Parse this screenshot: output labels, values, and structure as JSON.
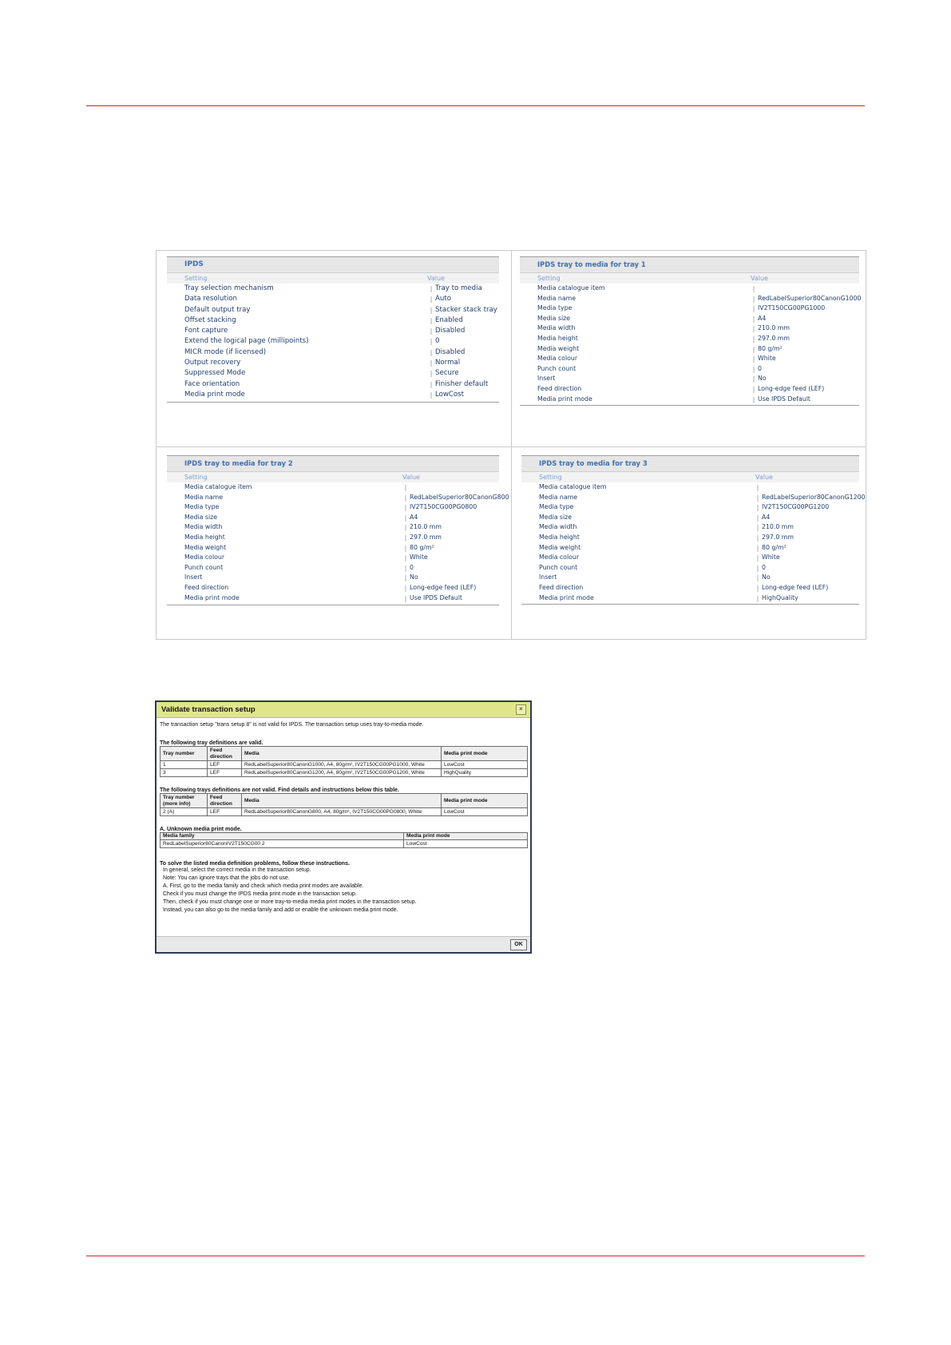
{
  "panels": {
    "ipds": {
      "title": "IPDS",
      "header_setting": "Setting",
      "header_value": "Value",
      "rows": [
        {
          "setting": "Tray selection mechanism",
          "value": "Tray to media"
        },
        {
          "setting": "Data resolution",
          "value": "Auto"
        },
        {
          "setting": "Default output tray",
          "value": "Stacker stack tray"
        },
        {
          "setting": "Offset stacking",
          "value": "Enabled"
        },
        {
          "setting": "Font capture",
          "value": "Disabled"
        },
        {
          "setting": "Extend the logical page (millipoints)",
          "value": "0"
        },
        {
          "setting": "MICR mode (if licensed)",
          "value": "Disabled"
        },
        {
          "setting": "Output recovery",
          "value": "Normal"
        },
        {
          "setting": "Suppressed Mode",
          "value": "Secure"
        },
        {
          "setting": "Face orientation",
          "value": "Finisher default"
        },
        {
          "setting": "Media print mode",
          "value": "LowCost"
        }
      ]
    },
    "tray1": {
      "title": "IPDS tray to media for tray 1",
      "header_setting": "Setting",
      "header_value": "Value",
      "rows": [
        {
          "setting": "Media catalogue item",
          "value": ""
        },
        {
          "setting": "Media name",
          "value": "RedLabelSuperior80CanonG1000"
        },
        {
          "setting": "Media type",
          "value": "IV2T150CG00PG1000"
        },
        {
          "setting": "Media size",
          "value": "A4"
        },
        {
          "setting": "Media width",
          "value": "210.0 mm"
        },
        {
          "setting": "Media height",
          "value": "297.0 mm"
        },
        {
          "setting": "Media weight",
          "value": "80 g/m²"
        },
        {
          "setting": "Media colour",
          "value": "White"
        },
        {
          "setting": "Punch count",
          "value": "0"
        },
        {
          "setting": "Insert",
          "value": "No"
        },
        {
          "setting": "Feed direction",
          "value": "Long-edge feed (LEF)"
        },
        {
          "setting": "Media print mode",
          "value": "Use IPDS Default"
        }
      ]
    },
    "tray2": {
      "title": "IPDS tray to media for tray 2",
      "header_setting": "Setting",
      "header_value": "Value",
      "rows": [
        {
          "setting": "Media catalogue item",
          "value": ""
        },
        {
          "setting": "Media name",
          "value": "RedLabelSuperior80CanonG800"
        },
        {
          "setting": "Media type",
          "value": "IV2T150CG00PG0800"
        },
        {
          "setting": "Media size",
          "value": "A4"
        },
        {
          "setting": "Media width",
          "value": "210.0 mm"
        },
        {
          "setting": "Media height",
          "value": "297.0 mm"
        },
        {
          "setting": "Media weight",
          "value": "80 g/m²"
        },
        {
          "setting": "Media colour",
          "value": "White"
        },
        {
          "setting": "Punch count",
          "value": "0"
        },
        {
          "setting": "Insert",
          "value": "No"
        },
        {
          "setting": "Feed direction",
          "value": "Long-edge feed (LEF)"
        },
        {
          "setting": "Media print mode",
          "value": "Use IPDS Default"
        }
      ]
    },
    "tray3": {
      "title": "IPDS tray to media for tray 3",
      "header_setting": "Setting",
      "header_value": "Value",
      "rows": [
        {
          "setting": "Media catalogue item",
          "value": ""
        },
        {
          "setting": "Media name",
          "value": "RedLabelSuperior80CanonG1200"
        },
        {
          "setting": "Media type",
          "value": "IV2T150CG00PG1200"
        },
        {
          "setting": "Media size",
          "value": "A4"
        },
        {
          "setting": "Media width",
          "value": "210.0 mm"
        },
        {
          "setting": "Media height",
          "value": "297.0 mm"
        },
        {
          "setting": "Media weight",
          "value": "80 g/m²"
        },
        {
          "setting": "Media colour",
          "value": "White"
        },
        {
          "setting": "Punch count",
          "value": "0"
        },
        {
          "setting": "Insert",
          "value": "No"
        },
        {
          "setting": "Feed direction",
          "value": "Long-edge feed (LEF)"
        },
        {
          "setting": "Media print mode",
          "value": "HighQuality"
        }
      ]
    }
  },
  "dialog": {
    "title": "Validate transaction setup",
    "close_glyph": "×",
    "intro": "The transaction setup \"trans setup 8\" is not valid for IPDS. The transaction setup uses tray-to-media mode.",
    "valid_heading": "The following tray definitions are valid.",
    "valid_headers": {
      "tray": "Tray number",
      "feed": "Feed direction",
      "media": "Media",
      "mode": "Media print mode"
    },
    "valid_rows": [
      {
        "tray": "1",
        "feed": "LEF",
        "media": "RedLabelSuperior80CanonG1000, A4, 80g/m², IV2T150CG00PG1000, White",
        "mode": "LowCost"
      },
      {
        "tray": "3",
        "feed": "LEF",
        "media": "RedLabelSuperior80CanonG1200, A4, 80g/m², IV2T150CG00PG1200, White",
        "mode": "HighQuality"
      }
    ],
    "invalid_heading": "The following trays definitions are not valid. Find details and instructions below this table.",
    "invalid_headers": {
      "tray": "Tray number (more info)",
      "feed": "Feed direction",
      "media": "Media",
      "mode": "Media print mode"
    },
    "invalid_rows": [
      {
        "tray": "2 (A)",
        "feed": "LEF",
        "media": "RedLabelSuperior80CanonG800, A4, 80g/m², IV2T150CG00PG0800, White",
        "mode": "LowCost"
      }
    ],
    "unknown_heading": "A. Unknown media print mode.",
    "unknown_headers": {
      "family": "Media family",
      "mode": "Media print mode"
    },
    "unknown_rows": [
      {
        "family": "RedLabelSuperior80CanonIV2T150CG00 2",
        "mode": "LowCost"
      }
    ],
    "solve_heading": "To solve the listed media definition problems, follow these instructions.",
    "solve_lines": [
      "In general, select the correct media in the transaction setup.",
      "Note: You can ignore trays that the jobs do not use.",
      "A. First, go to the media family and check which media print modes are available.",
      "Check if you must change the IPDS media print mode in the transaction setup.",
      "Then, check if you must change one or more tray-to-media media print modes in the transaction setup.",
      "Instead, you can also go to the media family and add or enable the unknown media print mode."
    ],
    "ok_label": "OK"
  }
}
